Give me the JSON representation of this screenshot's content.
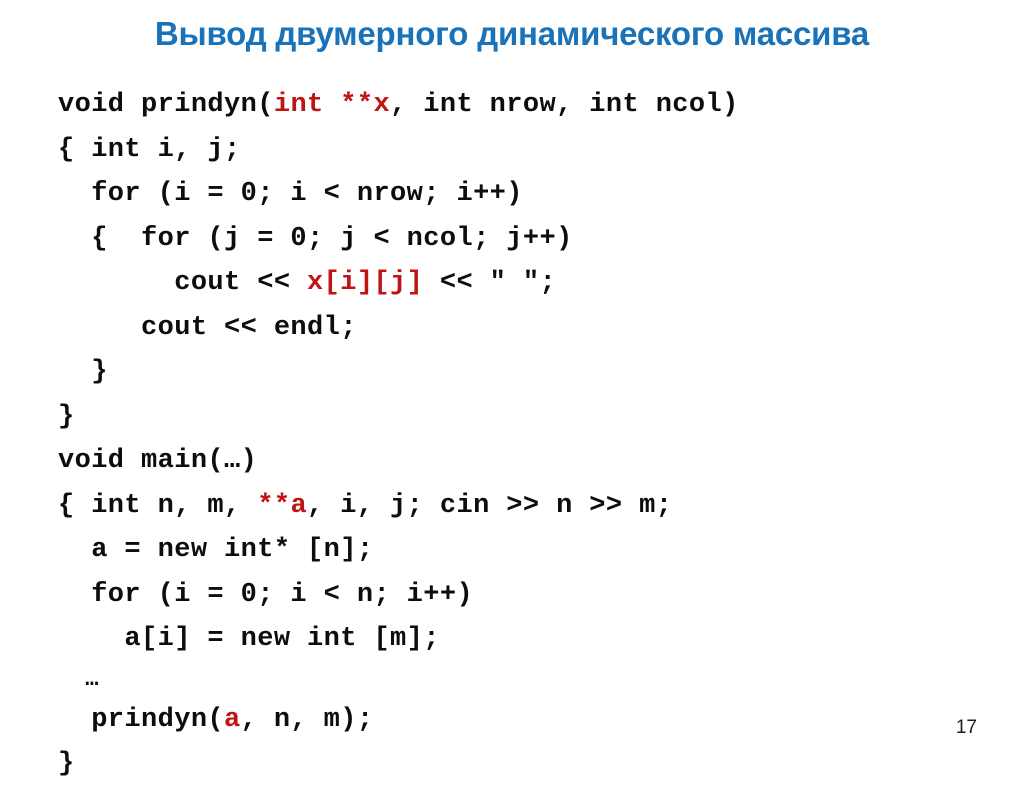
{
  "slide": {
    "title": "Вывод двумерного динамического массива",
    "title_color": "#1a72b8",
    "background_color": "#ffffff",
    "page_number": "17",
    "code_color": "#0d0d0d",
    "highlight_color": "#bf1414"
  },
  "code": {
    "lines": [
      {
        "id": "line-1",
        "segments": [
          {
            "text": "void prindyn(",
            "color": "black"
          },
          {
            "text": "int **x",
            "color": "red"
          },
          {
            "text": ", int nrow, int ncol)",
            "color": "black"
          }
        ]
      },
      {
        "id": "line-2",
        "segments": [
          {
            "text": "{ int i, j;",
            "color": "black"
          }
        ]
      },
      {
        "id": "line-3",
        "segments": [
          {
            "text": "  for (i = 0; i < nrow; i++)",
            "color": "black"
          }
        ]
      },
      {
        "id": "line-4",
        "segments": [
          {
            "text": "  {  for (j = 0; j < ncol; j++)",
            "color": "black"
          }
        ]
      },
      {
        "id": "line-5",
        "segments": [
          {
            "text": "       cout << ",
            "color": "black"
          },
          {
            "text": "x[i][j]",
            "color": "red"
          },
          {
            "text": " << \" \";",
            "color": "black"
          }
        ]
      },
      {
        "id": "line-6",
        "segments": [
          {
            "text": "     cout << endl;",
            "color": "black"
          }
        ]
      },
      {
        "id": "line-7",
        "segments": [
          {
            "text": "  }",
            "color": "black"
          }
        ]
      },
      {
        "id": "line-8",
        "segments": [
          {
            "text": "}",
            "color": "black"
          }
        ]
      },
      {
        "id": "line-9",
        "segments": [
          {
            "text": "void main(…)",
            "color": "black"
          }
        ]
      },
      {
        "id": "line-10",
        "segments": [
          {
            "text": "{ int n, m, ",
            "color": "black"
          },
          {
            "text": "**a",
            "color": "red"
          },
          {
            "text": ", i, j; cin >> n >> m;",
            "color": "black"
          }
        ]
      },
      {
        "id": "line-11",
        "segments": [
          {
            "text": "  a = new int* [n];",
            "color": "black"
          }
        ]
      },
      {
        "id": "line-12",
        "segments": [
          {
            "text": "  for (i = 0; i < n; i++)",
            "color": "black"
          }
        ]
      },
      {
        "id": "line-13",
        "segments": [
          {
            "text": "    a[i] = new int [m];",
            "color": "black"
          }
        ]
      },
      {
        "id": "line-14",
        "small": true,
        "segments": [
          {
            "text": "  …",
            "color": "black"
          }
        ]
      },
      {
        "id": "line-15",
        "segments": [
          {
            "text": "  prindyn(",
            "color": "black"
          },
          {
            "text": "a",
            "color": "red"
          },
          {
            "text": ", n, m);",
            "color": "black"
          }
        ]
      },
      {
        "id": "line-16",
        "segments": [
          {
            "text": "}",
            "color": "black"
          }
        ]
      }
    ]
  }
}
